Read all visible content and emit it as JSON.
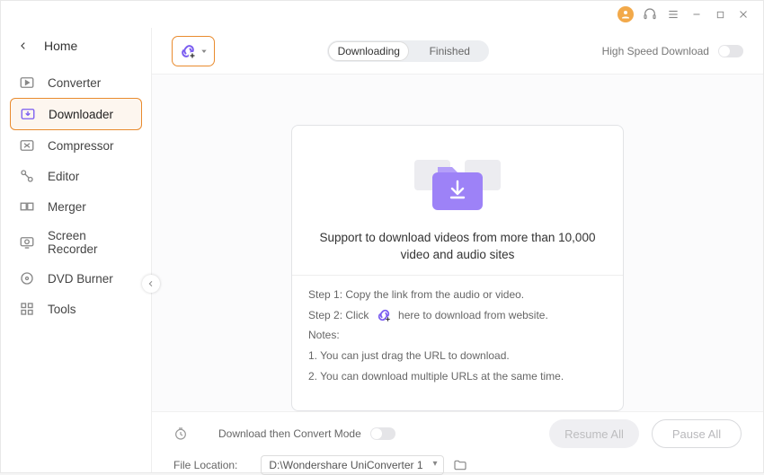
{
  "titlebar": {},
  "sidebar": {
    "home": "Home",
    "items": [
      {
        "label": "Converter"
      },
      {
        "label": "Downloader"
      },
      {
        "label": "Compressor"
      },
      {
        "label": "Editor"
      },
      {
        "label": "Merger"
      },
      {
        "label": "Screen Recorder"
      },
      {
        "label": "DVD Burner"
      },
      {
        "label": "Tools"
      }
    ],
    "activeIndex": 1
  },
  "toolbar": {
    "tabs": {
      "downloading": "Downloading",
      "finished": "Finished",
      "active": "downloading"
    },
    "highspeed_label": "High Speed Download"
  },
  "card": {
    "title": "Support to download videos from more than 10,000 video and audio sites",
    "step1": "Step 1: Copy the link from the audio or video.",
    "step2_a": "Step 2: Click",
    "step2_b": "here to download from website.",
    "notes_label": "Notes:",
    "note1": "1. You can just drag the URL to download.",
    "note2": "2. You can download multiple URLs at the same time."
  },
  "bottom": {
    "convert_label": "Download then Convert Mode",
    "location_label": "File Location:",
    "location_value": "D:\\Wondershare UniConverter 1",
    "resume": "Resume All",
    "pause": "Pause All"
  }
}
